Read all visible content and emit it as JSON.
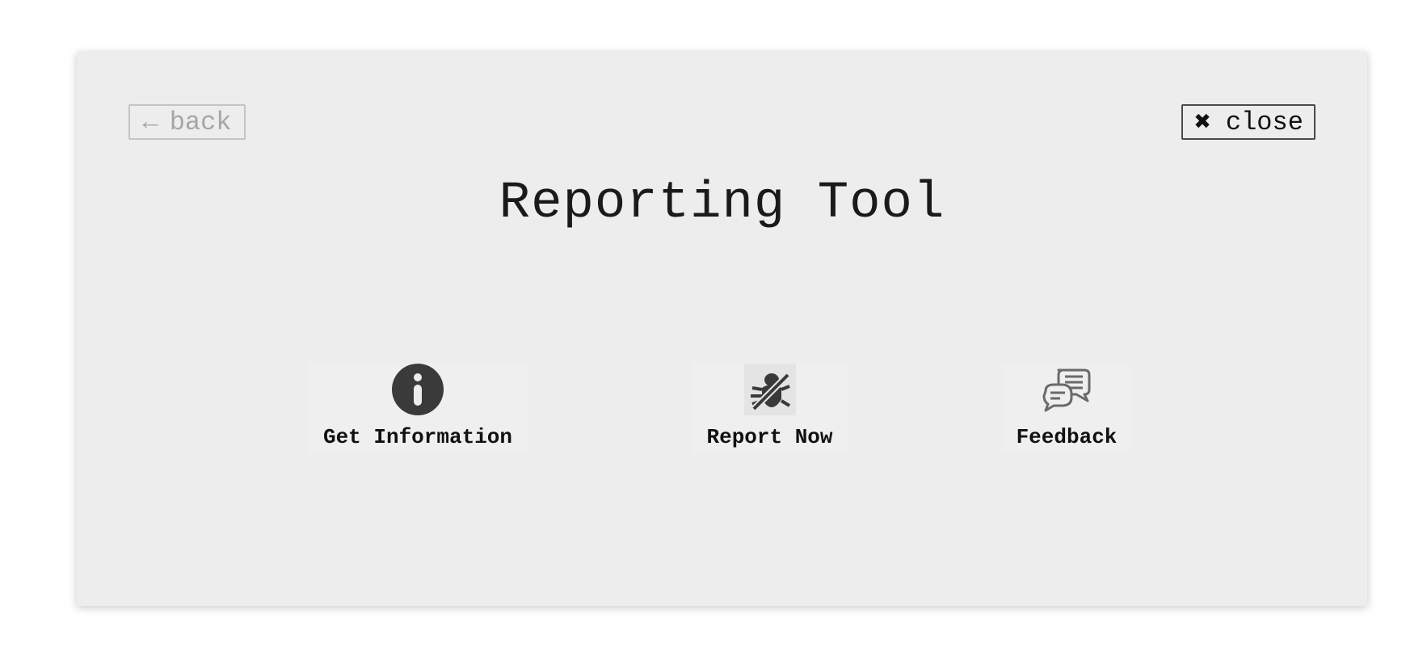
{
  "dialog": {
    "title": "Reporting Tool",
    "back_label": "back",
    "back_arrow": "←",
    "close_label": "close",
    "close_glyph": "✖"
  },
  "options": [
    {
      "label": "Get Information",
      "icon": "info-icon"
    },
    {
      "label": "Report Now",
      "icon": "bug-slash-icon"
    },
    {
      "label": "Feedback",
      "icon": "chat-bubbles-icon"
    }
  ],
  "colors": {
    "page_bg": "#ffffff",
    "panel_bg": "#ededed",
    "text": "#1a1a1a",
    "disabled": "#a6a6a6",
    "icon": "#3a3a3a"
  }
}
